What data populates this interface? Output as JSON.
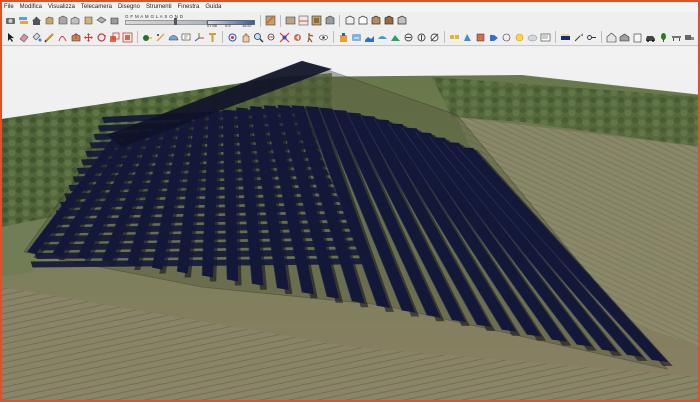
{
  "menu": [
    "File",
    "Modifica",
    "Visualizza",
    "Telecamera",
    "Disegno",
    "Strumenti",
    "Finestra",
    "Guida"
  ],
  "shadows": {
    "months": "G F M A M G L A S O N D",
    "time_start": "07:56",
    "time_mid": "0:5",
    "time_end": "16:57",
    "month_level": 0.62
  },
  "colors": {
    "frame": "#e0502a",
    "sky": "#efefef",
    "terrain": "#6f7b58",
    "panel": "#141838",
    "panel_shadow": "#0b0c18"
  },
  "toolbar1_icons": [
    "camera-icon",
    "layers-icon",
    "home-icon",
    "front-view-icon",
    "right-view-icon",
    "back-view-icon",
    "left-view-icon",
    "top-view-icon",
    "bottom-view-icon",
    "section-plane-icon",
    "display-section-icon",
    "section-cuts-icon",
    "xray-icon",
    "back-edges-icon",
    "wireframe-icon",
    "hidden-line-icon",
    "shaded-icon",
    "shaded-textures-icon",
    "monochrome-icon"
  ],
  "toolbar2_icons": [
    "select-arrow-icon",
    "eraser-icon",
    "paint-bucket-icon",
    "pencil-line-icon",
    "arc-icon",
    "push-pull-icon",
    "move-icon",
    "rotate-icon",
    "scale-icon",
    "offset-icon",
    "tape-measure-icon",
    "dimension-icon",
    "protractor-icon",
    "text-icon",
    "axes-icon",
    "3d-text-icon",
    "orbit-icon",
    "pan-icon",
    "zoom-icon",
    "zoom-window-icon",
    "zoom-extents-icon",
    "previous-view-icon",
    "walk-icon",
    "look-around-icon",
    "warehouse-icon",
    "extension-icon",
    "sandbox-icon",
    "smoove-icon",
    "stamp-icon",
    "drape-icon",
    "add-detail-icon",
    "flip-edge-icon",
    "component-icon",
    "material-icon",
    "style-icon",
    "tag-icon",
    "scene-icon",
    "shadows-icon",
    "fog-icon",
    "outliner-icon",
    "solar-icon",
    "shovel-icon",
    "key-icon",
    "building-icon",
    "warehouse-upload-icon",
    "cabinet-icon",
    "car-icon",
    "tree-icon",
    "bench-icon",
    "truck-icon",
    "sign-icon",
    "road-icon"
  ]
}
